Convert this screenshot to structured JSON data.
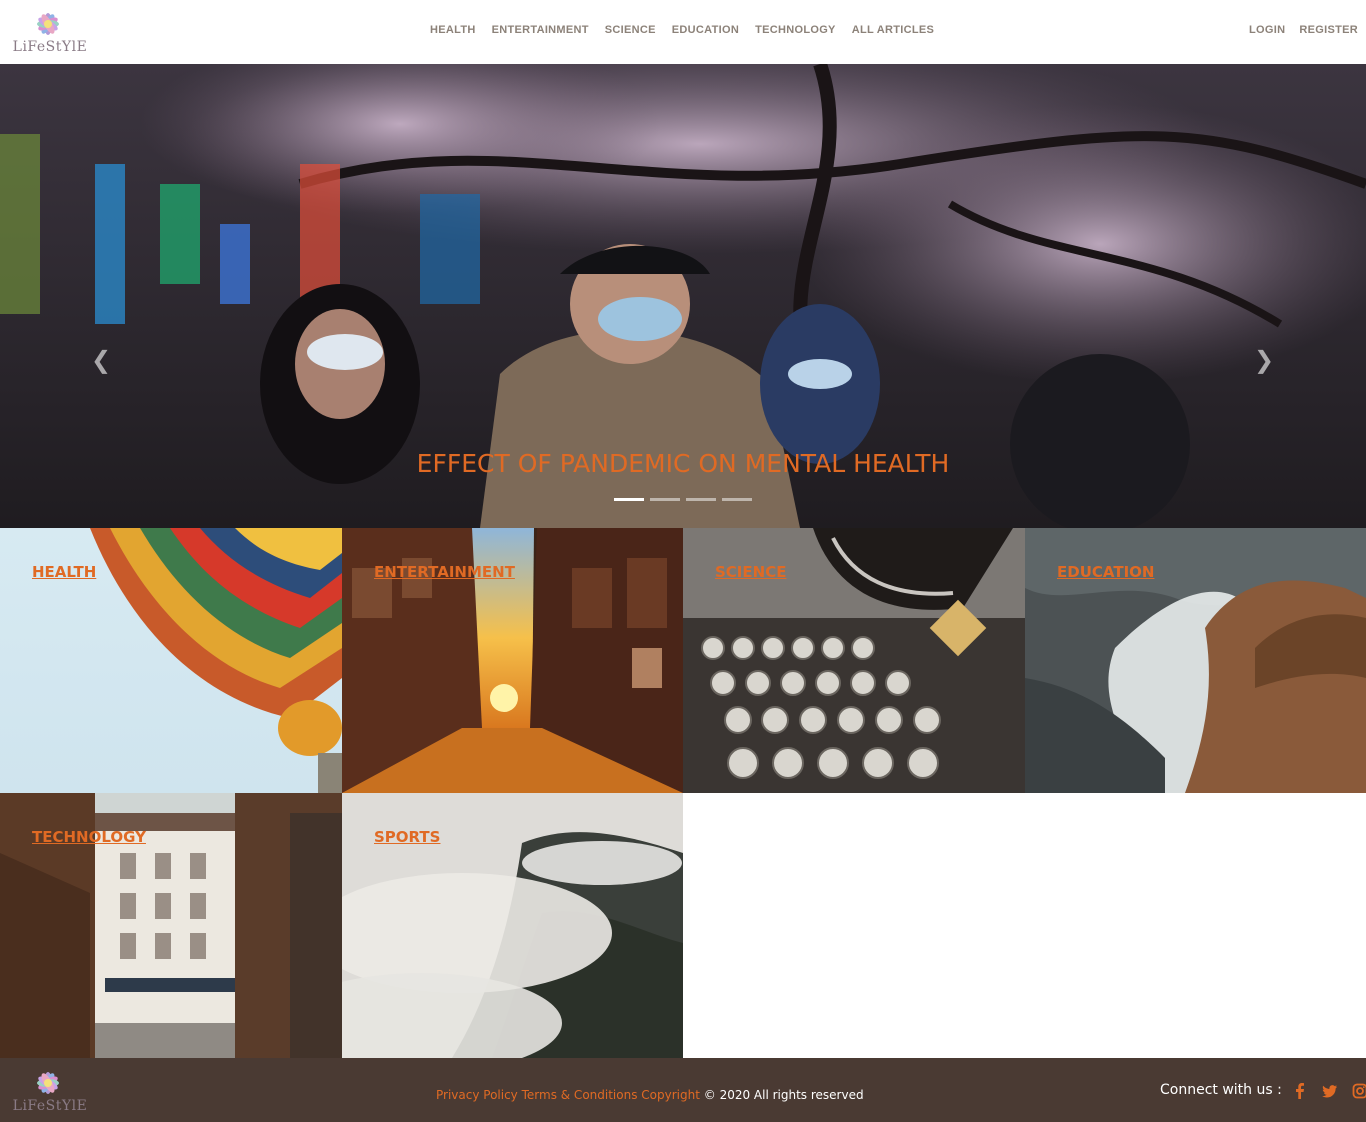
{
  "header": {
    "brand": "LiFeStYlE",
    "nav": [
      "HEALTH",
      "ENTERTAINMENT",
      "SCIENCE",
      "EDUCATION",
      "TECHNOLOGY",
      "ALL ARTICLES"
    ],
    "login": "LOGIN",
    "register": "REGISTER"
  },
  "hero": {
    "caption": "EFFECT OF PANDEMIC ON MENTAL HEALTH",
    "slide_count": 4,
    "active_slide": 1
  },
  "categories": [
    {
      "label": "HEALTH"
    },
    {
      "label": "ENTERTAINMENT"
    },
    {
      "label": "SCIENCE"
    },
    {
      "label": "EDUCATION"
    },
    {
      "label": "TECHNOLOGY"
    },
    {
      "label": "SPORTS"
    }
  ],
  "footer": {
    "brand": "LiFeStYlE",
    "privacy": "Privacy Policy",
    "terms": "Terms & Conditions",
    "copyright_label": "Copyright",
    "copyright_text": "© 2020 All rights reserved",
    "connect": "Connect with us :",
    "social_icons": [
      "facebook-icon",
      "twitter-icon",
      "instagram-icon"
    ]
  },
  "colors": {
    "accent": "#e06a24",
    "footer_bg": "#4a3a33",
    "nav_text": "#8c8279"
  }
}
